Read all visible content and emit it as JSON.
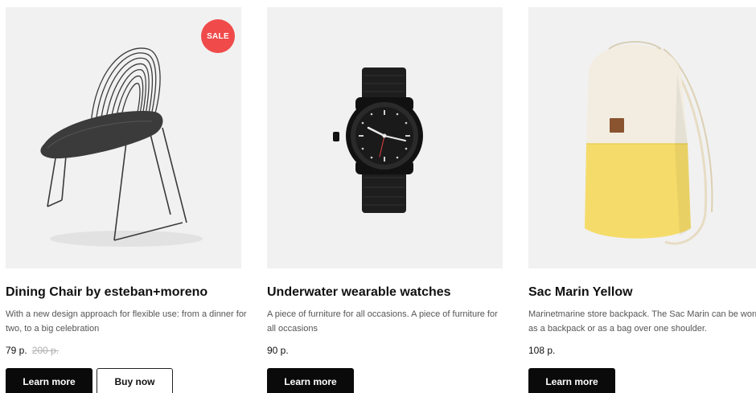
{
  "products": [
    {
      "badge": "SALE",
      "title": "Dining Chair by esteban+moreno",
      "description": "With a new design approach for flexible use: from a dinner for two, to a big celebration",
      "price": "79 р.",
      "old_price": "200 р.",
      "primary_button": "Learn more",
      "secondary_button": "Buy now"
    },
    {
      "title": "Underwater wearable watches",
      "description": "A piece of furniture for all occasions. A piece of furniture for all occasions",
      "price": "90 р.",
      "primary_button": "Learn more"
    },
    {
      "title": "Sac Marin Yellow",
      "description": "Marinetmarine store backpack. The Sac Marin can be worn as a backpack or as a bag over one shoulder.",
      "price": "108 р.",
      "primary_button": "Learn more"
    }
  ],
  "colors": {
    "badge": "#f04a4a",
    "button_dark": "#0a0a0a",
    "image_bg": "#f1f1f1",
    "backpack_yellow": "#f5dc6a",
    "backpack_cream": "#f2ede0"
  }
}
